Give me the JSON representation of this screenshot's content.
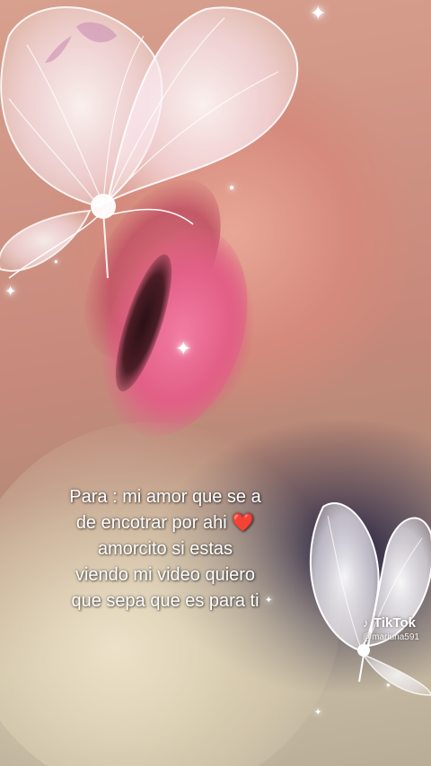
{
  "caption": {
    "lines": [
      "Para : mi  amor que se a",
      "de encotrar por ahi",
      "amorcito si estas",
      "viendo mi video quiero",
      "que sepa que es para ti"
    ],
    "emoji": "❤️"
  },
  "watermark": {
    "logo_glyph": "♪",
    "logo_text": "TikTok",
    "username": "@mariuna591"
  },
  "colors": {
    "lip_pink": "#e25f86",
    "skin": "#d58a7c",
    "caption_text": "#ffffff",
    "heart": "#e8252f"
  },
  "icons": [
    "butterfly-overlay-icon",
    "sparkle-icon",
    "tiktok-note-icon"
  ]
}
